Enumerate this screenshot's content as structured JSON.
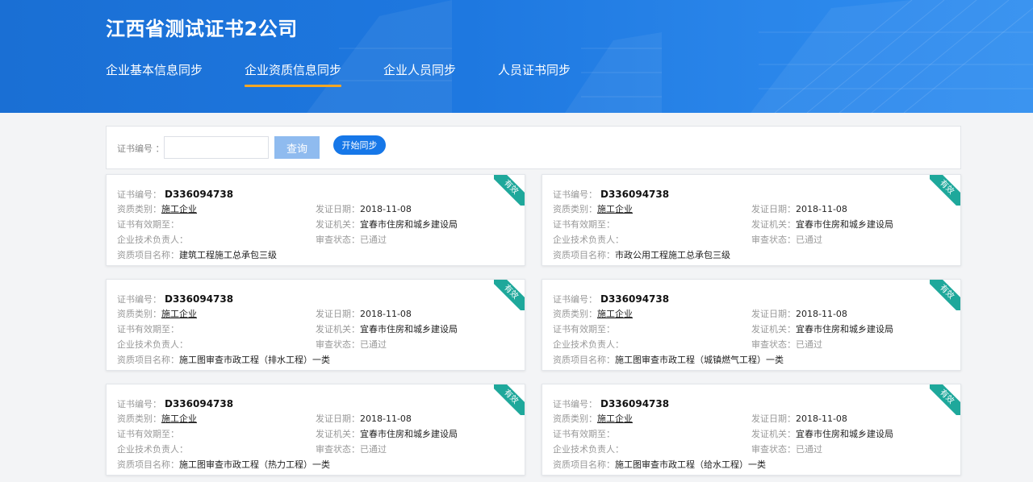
{
  "header": {
    "company_title": "江西省测试证书2公司",
    "nav": [
      {
        "label": "企业基本信息同步",
        "active": false
      },
      {
        "label": "企业资质信息同步",
        "active": true
      },
      {
        "label": "企业人员同步",
        "active": false
      },
      {
        "label": "人员证书同步",
        "active": false
      }
    ]
  },
  "search": {
    "label": "证书编号 ：",
    "input_value": "",
    "placeholder": "",
    "query_button": "查询",
    "sync_button": "开始同步"
  },
  "labels": {
    "cert_no": "证书编号：",
    "qual_type": "资质类别：",
    "valid_until": "证书有效期至：",
    "tech_lead": "企业技术负责人：",
    "item_name": "资质项目名称：",
    "issue_date": "发证日期：",
    "issuer": "发证机关：",
    "review_status": "审查状态："
  },
  "cards": [
    {
      "ribbon": "有效",
      "cert_no": "D336094738",
      "qual_type": "施工企业",
      "valid_until": "",
      "tech_lead": "",
      "item_name": "建筑工程施工总承包三级",
      "issue_date": "2018-11-08",
      "issuer": "宜春市住房和城乡建设局",
      "review_status": "已通过"
    },
    {
      "ribbon": "有效",
      "cert_no": "D336094738",
      "qual_type": "施工企业",
      "valid_until": "",
      "tech_lead": "",
      "item_name": "市政公用工程施工总承包三级",
      "issue_date": "2018-11-08",
      "issuer": "宜春市住房和城乡建设局",
      "review_status": "已通过"
    },
    {
      "ribbon": "有效",
      "cert_no": "D336094738",
      "qual_type": "施工企业",
      "valid_until": "",
      "tech_lead": "",
      "item_name": "施工图审查市政工程（排水工程）一类",
      "issue_date": "2018-11-08",
      "issuer": "宜春市住房和城乡建设局",
      "review_status": "已通过"
    },
    {
      "ribbon": "有效",
      "cert_no": "D336094738",
      "qual_type": "施工企业",
      "valid_until": "",
      "tech_lead": "",
      "item_name": "施工图审查市政工程（城镇燃气工程）一类",
      "issue_date": "2018-11-08",
      "issuer": "宜春市住房和城乡建设局",
      "review_status": "已通过"
    },
    {
      "ribbon": "有效",
      "cert_no": "D336094738",
      "qual_type": "施工企业",
      "valid_until": "",
      "tech_lead": "",
      "item_name": "施工图审查市政工程（热力工程）一类",
      "issue_date": "2018-11-08",
      "issuer": "宜春市住房和城乡建设局",
      "review_status": "已通过"
    },
    {
      "ribbon": "有效",
      "cert_no": "D336094738",
      "qual_type": "施工企业",
      "valid_until": "",
      "tech_lead": "",
      "item_name": "施工图审查市政工程（给水工程）一类",
      "issue_date": "2018-11-08",
      "issuer": "宜春市住房和城乡建设局",
      "review_status": "已通过"
    }
  ]
}
